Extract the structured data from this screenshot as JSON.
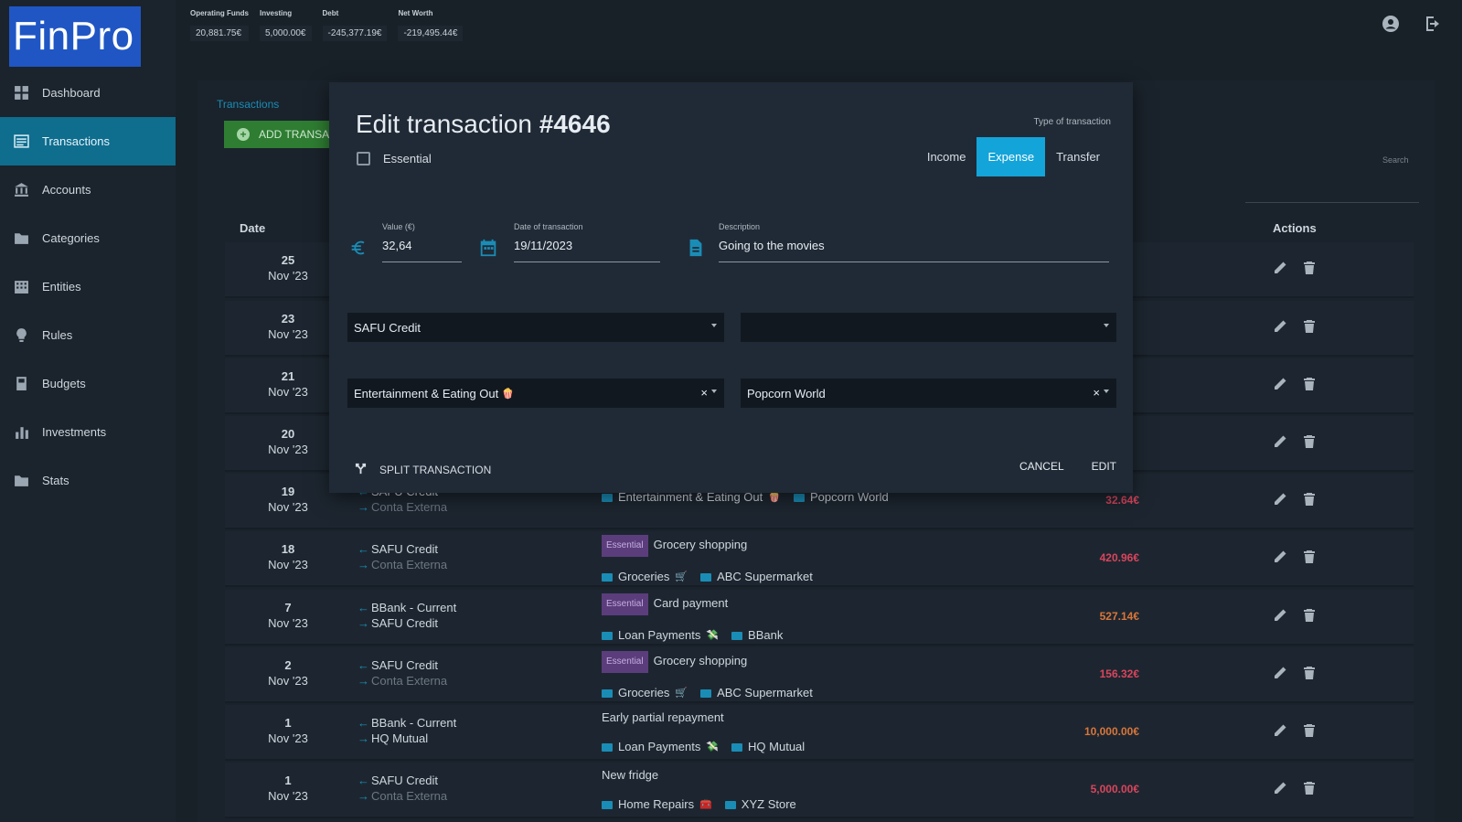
{
  "app": {
    "logo": "FinPro"
  },
  "nav": [
    {
      "label": "Dashboard",
      "icon": "dashboard-icon"
    },
    {
      "label": "Transactions",
      "icon": "list-icon",
      "active": true
    },
    {
      "label": "Accounts",
      "icon": "bank-icon"
    },
    {
      "label": "Categories",
      "icon": "folder-icon"
    },
    {
      "label": "Entities",
      "icon": "building-icon"
    },
    {
      "label": "Rules",
      "icon": "lightbulb-icon"
    },
    {
      "label": "Budgets",
      "icon": "book-icon"
    },
    {
      "label": "Investments",
      "icon": "bar-chart-icon"
    },
    {
      "label": "Stats",
      "icon": "folder-icon"
    }
  ],
  "summary": [
    {
      "label": "Operating Funds",
      "value": "20,881.75€"
    },
    {
      "label": "Investing",
      "value": "5,000.00€"
    },
    {
      "label": "Debt",
      "value": "-245,377.19€"
    },
    {
      "label": "Net Worth",
      "value": "-219,495.44€"
    }
  ],
  "page": {
    "breadcrumb": "Transactions",
    "add_button": "ADD TRANSA",
    "search_label": "Search",
    "columns": {
      "date": "Date",
      "actions": "Actions"
    }
  },
  "rows": [
    {
      "day": "25",
      "month": "Nov '23"
    },
    {
      "day": "23",
      "month": "Nov '23"
    },
    {
      "day": "21",
      "month": "Nov '23"
    },
    {
      "day": "20",
      "month": "Nov '23"
    },
    {
      "day": "19",
      "month": "Nov '23",
      "from": "SAFU Credit",
      "to": "Conta Externa",
      "to_dim": true,
      "badge": "",
      "description": "",
      "category": "Entertainment & Eating Out",
      "cat_emoji": "🍿",
      "entity": "Popcorn World",
      "amount": "32.64€",
      "amount_color": "red"
    },
    {
      "day": "18",
      "month": "Nov '23",
      "from": "SAFU Credit",
      "to": "Conta Externa",
      "to_dim": true,
      "badge": "Essential",
      "description": "Grocery shopping",
      "category": "Groceries",
      "cat_emoji": "🛒",
      "entity": "ABC Supermarket",
      "amount": "420.96€",
      "amount_color": "red"
    },
    {
      "day": "7",
      "month": "Nov '23",
      "from": "BBank - Current",
      "to": "SAFU Credit",
      "to_dim": false,
      "badge": "Essential",
      "description": "Card payment",
      "category": "Loan Payments",
      "cat_emoji": "💸",
      "entity": "BBank",
      "amount": "527.14€",
      "amount_color": "orange"
    },
    {
      "day": "2",
      "month": "Nov '23",
      "from": "SAFU Credit",
      "to": "Conta Externa",
      "to_dim": true,
      "badge": "Essential",
      "description": "Grocery shopping",
      "category": "Groceries",
      "cat_emoji": "🛒",
      "entity": "ABC Supermarket",
      "amount": "156.32€",
      "amount_color": "red"
    },
    {
      "day": "1",
      "month": "Nov '23",
      "from": "BBank - Current",
      "to": "HQ Mutual",
      "to_dim": false,
      "badge": "",
      "description": "Early partial repayment",
      "category": "Loan Payments",
      "cat_emoji": "💸",
      "entity": "HQ Mutual",
      "amount": "10,000.00€",
      "amount_color": "orange"
    },
    {
      "day": "1",
      "month": "Nov '23",
      "from": "SAFU Credit",
      "to": "Conta Externa",
      "to_dim": true,
      "badge": "",
      "description": "New fridge",
      "category": "Home Repairs",
      "cat_emoji": "🧰",
      "entity": "XYZ Store",
      "amount": "5,000.00€",
      "amount_color": "red"
    }
  ],
  "modal": {
    "title_prefix": "Edit transaction ",
    "title_id": "#4646",
    "essential_label": "Essential",
    "type_label": "Type of transaction",
    "types": [
      "Income",
      "Expense",
      "Transfer"
    ],
    "active_type": "Expense",
    "value_label": "Value (€)",
    "value": "32,64",
    "date_label": "Date of transaction",
    "date": "19/11/2023",
    "description_label": "Description",
    "description": "Going to the movies",
    "account_from": "SAFU Credit",
    "account_to": "",
    "category": "Entertainment & Eating Out",
    "category_emoji": "🍿",
    "entity": "Popcorn World",
    "clear_symbol": "×",
    "split_label": "SPLIT TRANSACTION",
    "cancel_label": "CANCEL",
    "edit_label": "EDIT"
  },
  "colors": {
    "accent": "#1a8db6",
    "active_nav": "#0f6d8e",
    "expense_btn": "#13a4d9",
    "essential_badge": "#5b3d7c",
    "amount_red": "#d9455d",
    "amount_orange": "#d9763a",
    "logo_bg": "#1f56c4"
  }
}
